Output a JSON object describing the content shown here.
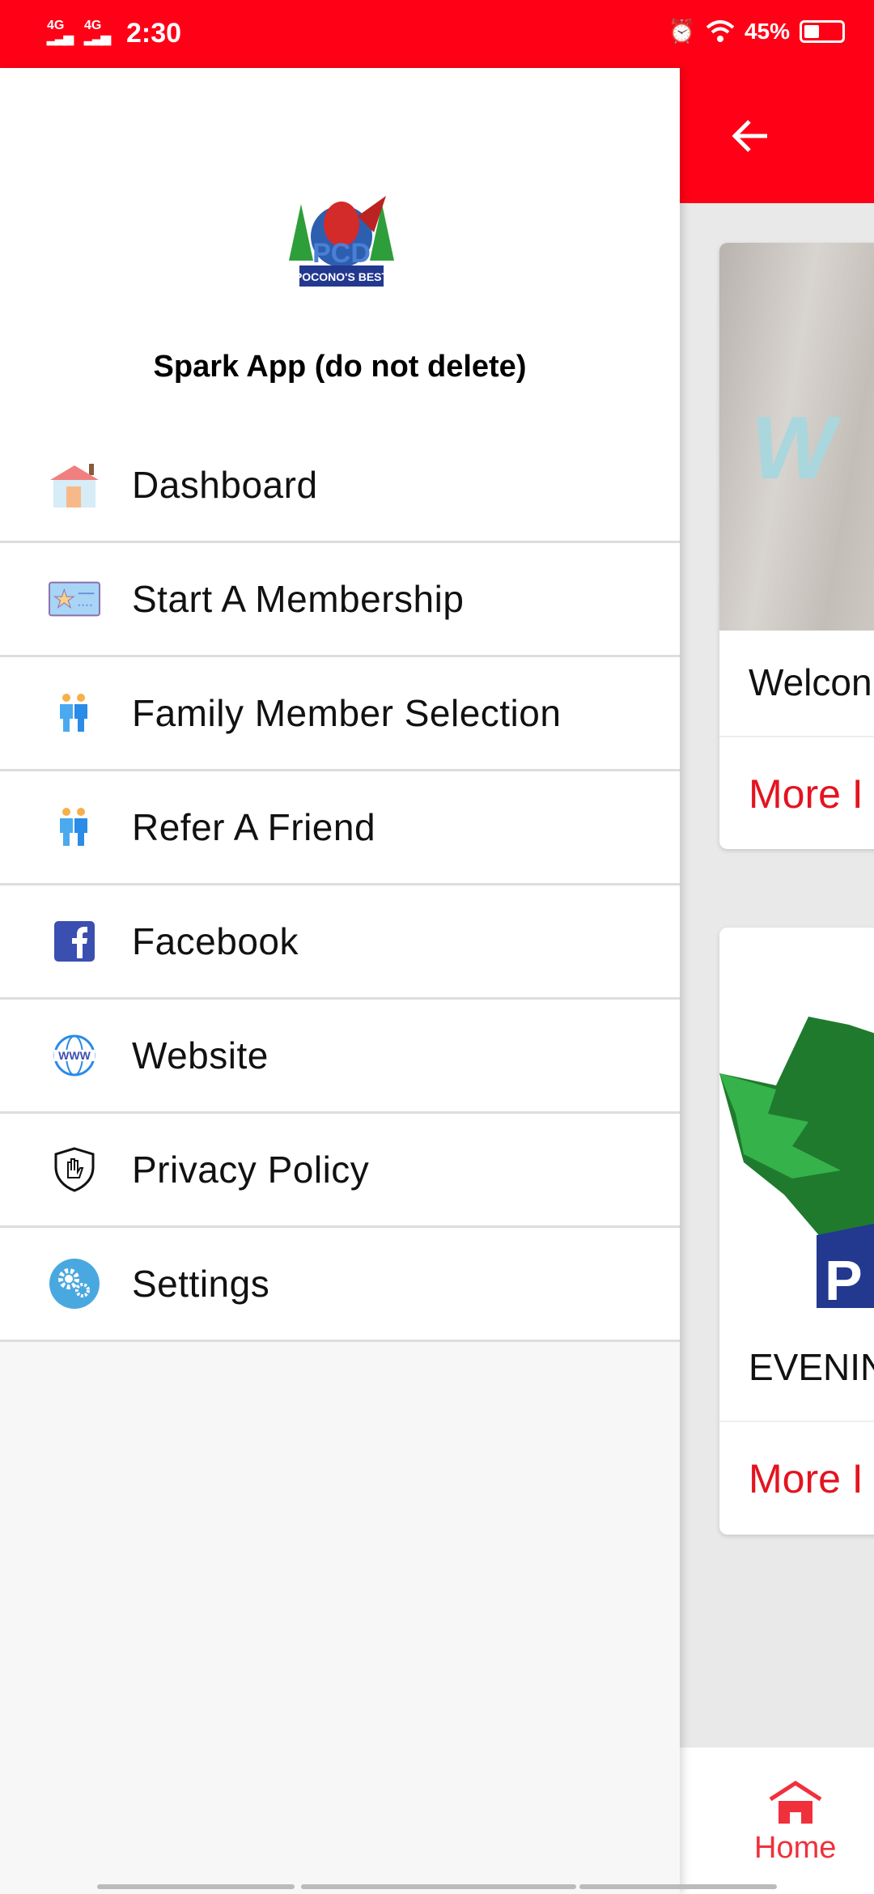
{
  "status_bar": {
    "network1": "4G",
    "network2": "4G",
    "time": "2:30",
    "battery": "45%",
    "battery_level": 0.45,
    "icons": [
      "signal-icon",
      "alarm-icon",
      "wifi-icon",
      "battery-icon"
    ]
  },
  "colors": {
    "brand": "#ff0016",
    "accent_text": "#e4131f"
  },
  "drawer": {
    "app_title": "Spark App (do not delete)",
    "logo_text": "PCD POCONO'S BEST",
    "items": [
      {
        "label": "Dashboard",
        "icon": "house-icon"
      },
      {
        "label": "Start A Membership",
        "icon": "membership-card-icon"
      },
      {
        "label": "Family Member Selection",
        "icon": "family-icon"
      },
      {
        "label": "Refer A Friend",
        "icon": "people-icon"
      },
      {
        "label": "Facebook",
        "icon": "facebook-icon"
      },
      {
        "label": "Website",
        "icon": "globe-www-icon"
      },
      {
        "label": "Privacy Policy",
        "icon": "shield-hand-icon"
      },
      {
        "label": "Settings",
        "icon": "gears-icon"
      }
    ]
  },
  "main": {
    "cards": [
      {
        "title": "Welcon",
        "more": "More I"
      },
      {
        "title": "EVENIN",
        "more": "More I"
      }
    ],
    "bottom_nav": {
      "home": "Home"
    }
  }
}
